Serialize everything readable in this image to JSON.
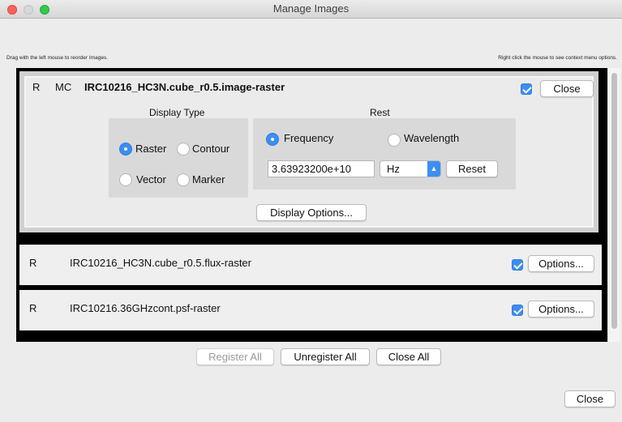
{
  "window": {
    "title": "Manage Images"
  },
  "hints": {
    "left": "Drag with the left mouse to reorder Images.",
    "right": "Right click the mouse to see context menu options."
  },
  "rows": [
    {
      "flag_r": "R",
      "flag_mc": "MC",
      "name": "IRC10216_HC3N.cube_r0.5.image-raster",
      "checked": true,
      "button": "Close",
      "display_type": {
        "title": "Display Type",
        "options": [
          "Raster",
          "Contour",
          "Vector",
          "Marker"
        ],
        "selected": "Raster"
      },
      "rest": {
        "title": "Rest",
        "options": [
          "Frequency",
          "Wavelength"
        ],
        "selected": "Frequency",
        "value": "3.63923200e+10",
        "unit": "Hz",
        "reset_label": "Reset"
      },
      "display_options_label": "Display Options..."
    },
    {
      "flag_r": "R",
      "name": "IRC10216_HC3N.cube_r0.5.flux-raster",
      "checked": true,
      "button": "Options..."
    },
    {
      "flag_r": "R",
      "name": "IRC10216.36GHzcont.psf-raster",
      "checked": true,
      "button": "Options..."
    }
  ],
  "footer": {
    "register_all": "Register All",
    "unregister_all": "Unregister All",
    "close_all": "Close All",
    "close": "Close"
  },
  "colors": {
    "accent": "#3a8ef6",
    "list_border": "#000000",
    "window_bg": "#ececec"
  }
}
